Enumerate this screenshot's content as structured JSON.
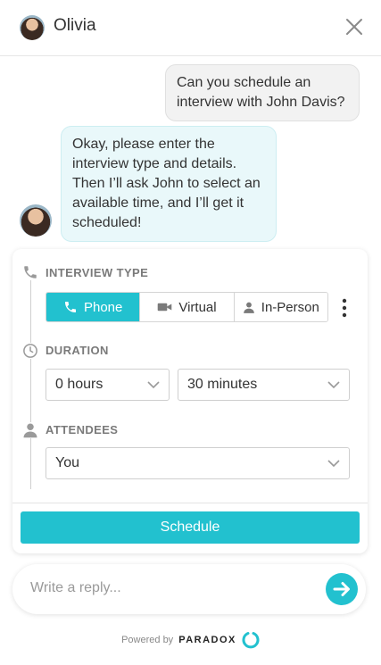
{
  "header": {
    "agent_name": "Olivia",
    "close_icon": "close-icon"
  },
  "messages": [
    {
      "from": "user",
      "text": "Can you schedule an interview with John Davis?"
    },
    {
      "from": "bot",
      "text": "Okay, please enter the interview type and details. Then I’ll ask John to select an available time, and I’ll get it scheduled!"
    }
  ],
  "form": {
    "interview_type": {
      "label": "INTERVIEW TYPE",
      "icon": "phone-icon",
      "options": [
        {
          "label": "Phone",
          "icon": "phone-icon",
          "selected": true
        },
        {
          "label": "Virtual",
          "icon": "video-camera-icon",
          "selected": false
        },
        {
          "label": "In-Person",
          "icon": "person-icon",
          "selected": false
        }
      ]
    },
    "duration": {
      "label": "DURATION",
      "icon": "clock-icon",
      "hours_value": "0 hours",
      "minutes_value": "30 minutes"
    },
    "attendees": {
      "label": "ATTENDEES",
      "icon": "person-icon",
      "value": "You"
    },
    "schedule_label": "Schedule"
  },
  "reply": {
    "placeholder": "Write a reply..."
  },
  "footer": {
    "powered_by": "Powered by",
    "brand": "PARADOX"
  },
  "colors": {
    "accent": "#22c1cf",
    "bot_bubble": "#e9f8fa",
    "user_bubble": "#f2f2f2"
  }
}
